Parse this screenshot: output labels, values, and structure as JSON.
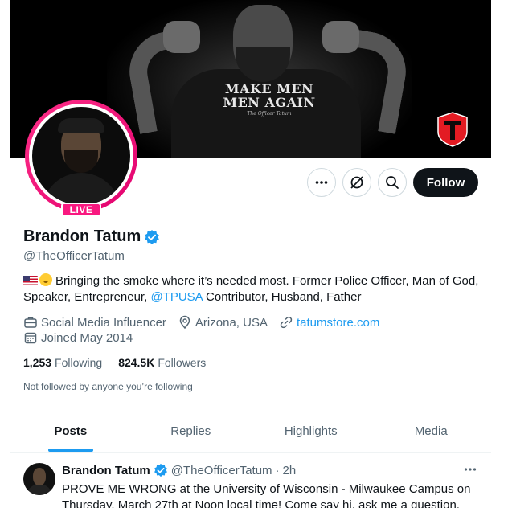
{
  "banner": {
    "shirt_line1": "MAKE MEN",
    "shirt_line2": "MEN AGAIN",
    "shirt_signature": "The Officer Tatum",
    "logo_letter": "T"
  },
  "profile": {
    "live_label": "LIVE",
    "name": "Brandon Tatum",
    "handle": "@TheOfficerTatum",
    "bio_part1": "Bringing the smoke where it’s needed most. Former Police Officer, Man of God, Speaker, Entrepreneur, ",
    "bio_link": "@TPUSA",
    "bio_part2": " Contributor, Husband, Father",
    "category": "Social Media Influencer",
    "location": "Arizona, USA",
    "website": "tatumstore.com",
    "joined": "Joined May 2014",
    "following_count": "1,253",
    "following_label": "Following",
    "followers_count": "824.5K",
    "followers_label": "Followers",
    "not_followed": "Not followed by anyone you’re following"
  },
  "actions": {
    "more_icon": "more-icon",
    "grok_icon": "grok-icon",
    "search_icon": "search-icon",
    "follow_label": "Follow"
  },
  "tabs": [
    {
      "label": "Posts",
      "active": true
    },
    {
      "label": "Replies",
      "active": false
    },
    {
      "label": "Highlights",
      "active": false
    },
    {
      "label": "Media",
      "active": false
    }
  ],
  "post": {
    "name": "Brandon Tatum",
    "handle": "@TheOfficerTatum",
    "separator": "·",
    "time": "2h",
    "text": "PROVE ME WRONG at the University of Wisconsin - Milwaukee Campus on Thursday, March 27th at Noon local time! Come say hi, ask me a question,"
  },
  "colors": {
    "accent": "#1d9bf0",
    "live": "#f91880",
    "text": "#0f1419",
    "muted": "#536471"
  }
}
